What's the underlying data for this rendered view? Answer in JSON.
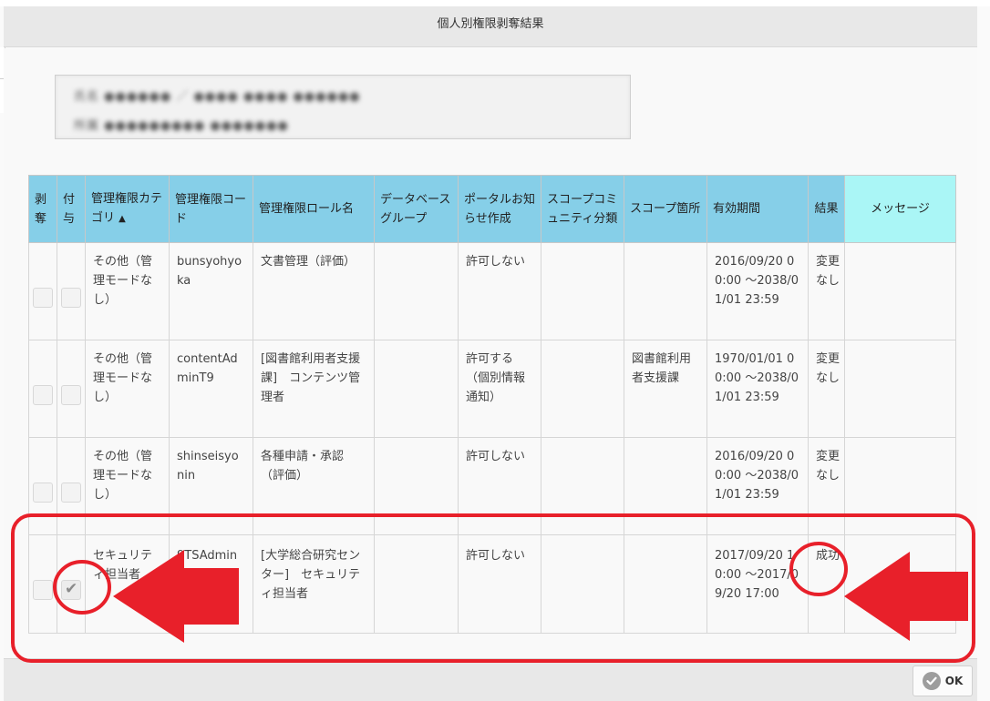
{
  "dialog": {
    "title": "個人別権限剥奪結果"
  },
  "user_info": {
    "line1": "氏名 ●●●●●● ／ ●●●● ●●●● ●●●●●●",
    "line2": "所属 ●●●●●●●●● ●●●●●●●"
  },
  "table": {
    "headers": {
      "revoke": "剥奪",
      "grant": "付与",
      "category": "管理権限カテゴリ",
      "category_sort": "▲",
      "code": "管理権限コード",
      "role": "管理権限ロール名",
      "db_group": "データベースグループ",
      "portal": "ポータルお知らせ作成",
      "scope_community": "スコープコミュニティ分類",
      "scope_location": "スコープ箇所",
      "period": "有効期間",
      "result": "結果",
      "message": "メッセージ"
    },
    "rows": [
      {
        "revoke_checked": false,
        "grant_checked": false,
        "category": "その他（管理モードなし）",
        "code": "bunsyohyoka",
        "role": "文書管理（評価）",
        "db_group": "",
        "portal": "許可しない",
        "scope_community": "",
        "scope_location": "",
        "period": "2016/09/20 00:00 ～2038/01/01 23:59",
        "result": "変更なし",
        "message": ""
      },
      {
        "revoke_checked": false,
        "grant_checked": false,
        "category": "その他（管理モードなし）",
        "code": "contentAdminT9",
        "role": "[図書館利用者支援課]　コンテンツ管理者",
        "db_group": "",
        "portal": "許可する（個別情報通知）",
        "scope_community": "",
        "scope_location": "図書館利用者支援課",
        "period": "1970/01/01 00:00 ～2038/01/01 23:59",
        "result": "変更なし",
        "message": ""
      },
      {
        "revoke_checked": false,
        "grant_checked": false,
        "category": "その他（管理モードなし）",
        "code": "shinseisyonin",
        "role": "各種申請・承認（評価）",
        "db_group": "",
        "portal": "許可しない",
        "scope_community": "",
        "scope_location": "",
        "period": "2016/09/20 00:00 ～2038/01/01 23:59",
        "result": "変更なし",
        "message": ""
      },
      {
        "revoke_checked": false,
        "grant_checked": true,
        "category": "セキュリティ担当者",
        "code": "9TSAdmin",
        "role": "[大学総合研究センター]　セキュリティ担当者",
        "db_group": "",
        "portal": "許可しない",
        "scope_community": "",
        "scope_location": "",
        "period": "2017/09/20 10:00 ～2017/09/20 17:00",
        "result": "成功",
        "message": ""
      }
    ]
  },
  "footer": {
    "ok_label": "OK"
  },
  "annotations": {
    "color": "#e8202a"
  }
}
